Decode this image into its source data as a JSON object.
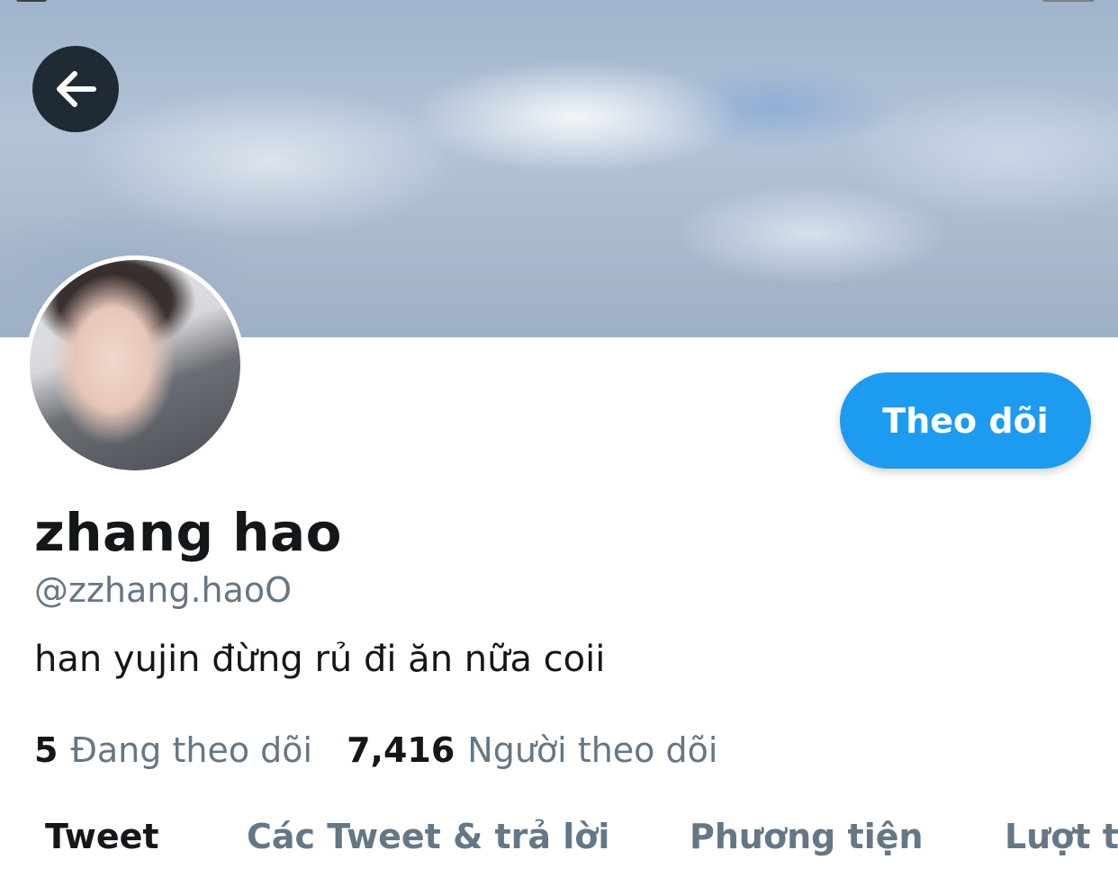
{
  "header": {
    "back_icon": "arrow-left-icon"
  },
  "profile": {
    "display_name": "zhang hao",
    "handle": "@zzhang.haoO",
    "bio": "han yujin đừng rủ đi ăn nữa coii",
    "follow_button_label": "Theo dõi"
  },
  "stats": [
    {
      "count": "5",
      "label": "Đang theo dõi"
    },
    {
      "count": "7,416",
      "label": "Người theo dõi"
    }
  ],
  "tabs": [
    {
      "label": "Tweet",
      "active": true
    },
    {
      "label": "Các Tweet & trả lời",
      "active": false
    },
    {
      "label": "Phương tiện",
      "active": false
    },
    {
      "label": "Lượt t",
      "active": false
    }
  ],
  "colors": {
    "accent": "#1d9bf0",
    "text_primary": "#14171a",
    "text_secondary": "#657786"
  }
}
